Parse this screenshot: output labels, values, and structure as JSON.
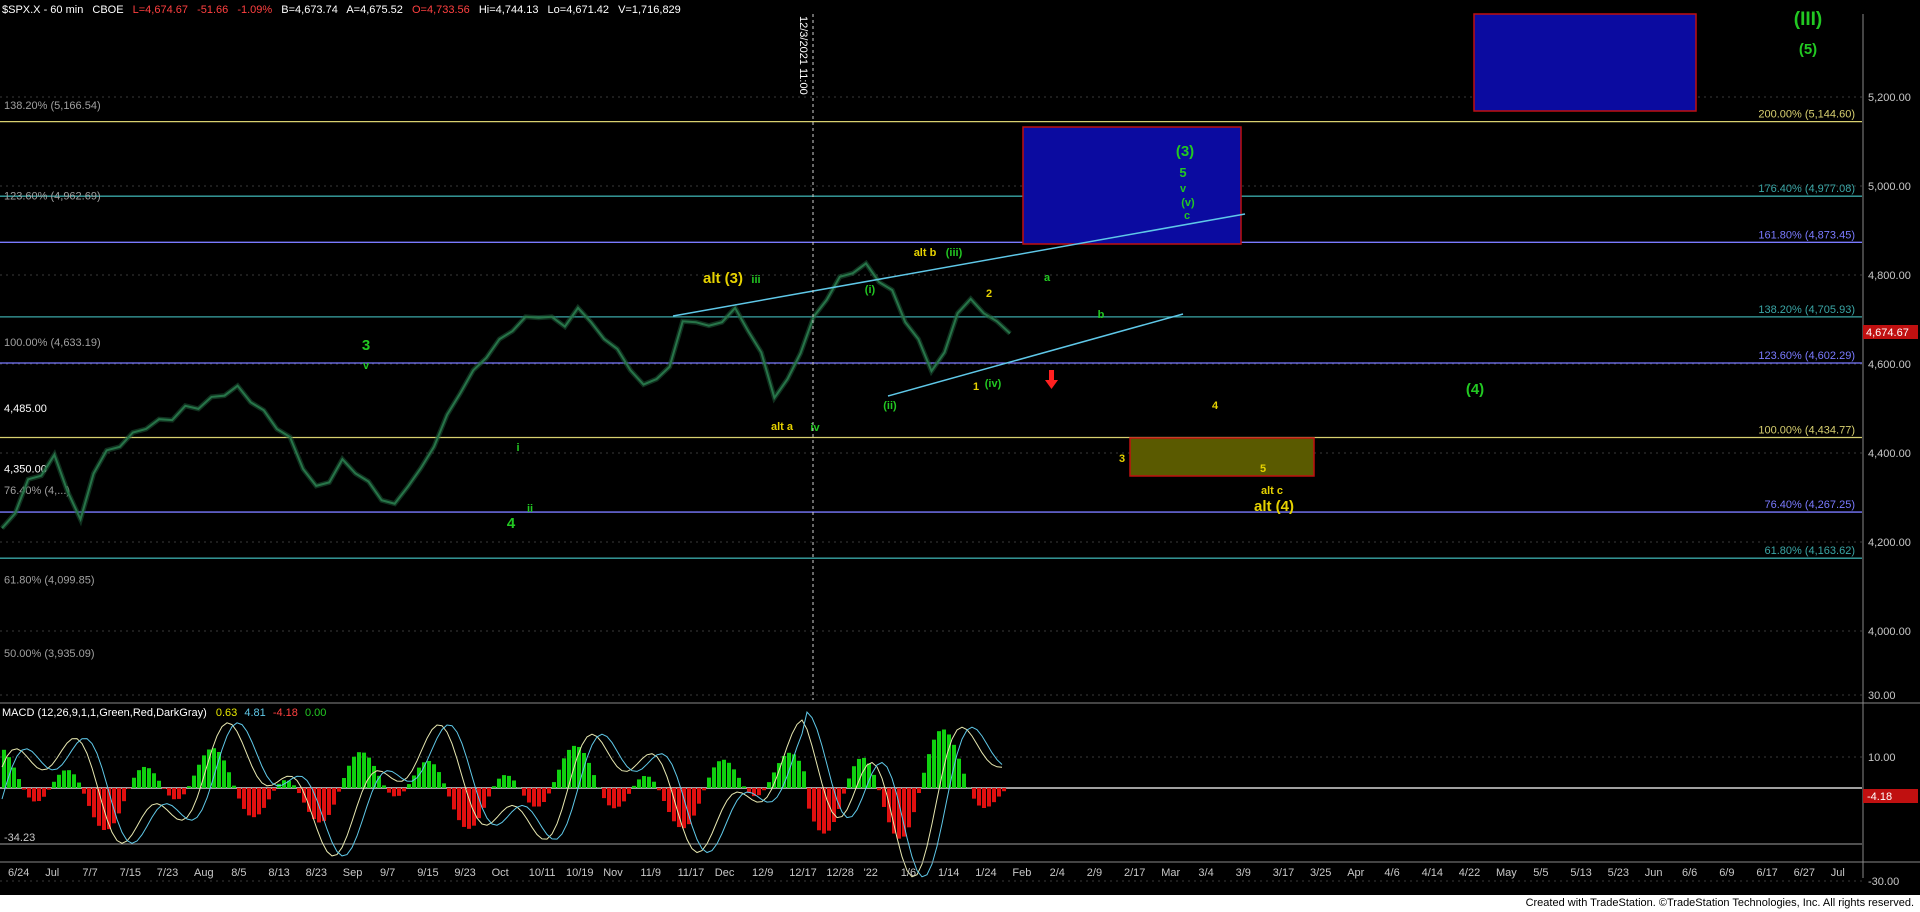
{
  "colors": {
    "background": "#000000",
    "price": "#2e8b57",
    "grid": "#3a3a3a",
    "axis_text": "#c8c8c8",
    "fib_yellow": "#d8d070",
    "fib_blue": "#7a7aff",
    "fib_teal": "#3aa6a6",
    "wave_green": "#22c822",
    "wave_yellow": "#e6d200",
    "box_blue": "#0b0ba0",
    "box_red": "#c01010",
    "box_olive": "#5a5a00",
    "trend": "#5fc8e8",
    "macd_pos": "#10d010",
    "macd_neg": "#e01010",
    "macd_line": "#e8e8b0"
  },
  "header": {
    "symbol": "$SPX.X - 60 min",
    "exchange": "CBOE",
    "last": "L=4,674.67",
    "change": "-51.66",
    "change_pct": "-1.09%",
    "bid": "B=4,673.74",
    "ask": "A=4,675.52",
    "open": "O=4,733.56",
    "high": "Hi=4,744.13",
    "low": "Lo=4,671.42",
    "volume": "V=1,716,829"
  },
  "cursor_date": "12/3/2021 11:00",
  "chart_data": {
    "type": "line",
    "price_axis": {
      "ticks": [
        "5,200.00",
        "5,000.00",
        "4,800.00",
        "4,600.00",
        "4,400.00",
        "4,200.00",
        "4,000.00"
      ],
      "last_price": "4,674.67"
    },
    "x_axis": {
      "ticks": [
        "6/24",
        "Jul",
        "7/7",
        "7/15",
        "7/23",
        "Aug",
        "8/5",
        "8/13",
        "8/23",
        "Sep",
        "9/7",
        "9/15",
        "9/23",
        "Oct",
        "10/11",
        "10/19",
        "Nov",
        "11/9",
        "11/17",
        "Dec",
        "12/9",
        "12/17",
        "12/28",
        "'22",
        "1/6",
        "1/14",
        "1/24",
        "Feb",
        "2/4",
        "2/9",
        "2/17",
        "Mar",
        "3/4",
        "3/9",
        "3/17",
        "3/25",
        "Apr",
        "4/6",
        "4/14",
        "4/22",
        "May",
        "5/5",
        "5/13",
        "5/23",
        "Jun",
        "6/6",
        "6/9",
        "6/17",
        "6/27",
        "Jul"
      ]
    },
    "series": [
      {
        "values": [
          4225,
          4270,
          4335,
          4355,
          4390,
          4320,
          4245,
          4360,
          4400,
          4420,
          4440,
          4460,
          4470,
          4480,
          4500,
          4505,
          4520,
          4535,
          4545,
          4520,
          4490,
          4460,
          4430,
          4370,
          4320,
          4340,
          4380,
          4360,
          4330,
          4300,
          4280,
          4330,
          4360,
          4420,
          4480,
          4540,
          4580,
          4620,
          4650,
          4680,
          4700,
          4710,
          4700,
          4690,
          4720,
          4700,
          4650,
          4640,
          4580,
          4560,
          4560,
          4600,
          4690,
          4700,
          4680,
          4700,
          4720,
          4680,
          4620,
          4530,
          4560,
          4630,
          4700,
          4750,
          4790,
          4810,
          4820,
          4790,
          4760,
          4700,
          4650,
          4590,
          4620,
          4720,
          4740,
          4720,
          4690,
          4674.67
        ]
      }
    ],
    "fib_levels": [
      {
        "label": "200.00% (5,144.60)",
        "side": "right",
        "value": 5144.6
      },
      {
        "label": "176.40% (4,977.08)",
        "side": "right",
        "value": 4977.08
      },
      {
        "label": "161.80% (4,873.45)",
        "side": "right",
        "value": 4873.45
      },
      {
        "label": "138.20% (4,705.93)",
        "side": "right",
        "value": 4705.93
      },
      {
        "label": "123.60% (4,602.29)",
        "side": "right",
        "value": 4602.29
      },
      {
        "label": "100.00% (4,434.77)",
        "side": "right",
        "value": 4434.77
      },
      {
        "label": "76.40% (4,267.25)",
        "side": "right",
        "value": 4267.25
      },
      {
        "label": "61.80% (4,163.62)",
        "side": "right",
        "value": 4163.62
      },
      {
        "label": "138.20% (5,166.54)",
        "side": "left",
        "value": 5166.54
      },
      {
        "label": "123.60% (4,962.69)",
        "side": "left",
        "value": 4962.69
      },
      {
        "label": "100.00% (4,633.19)",
        "side": "left",
        "value": 4633.19
      },
      {
        "label": "4,485.00",
        "side": "left",
        "value": 4485
      },
      {
        "label": "4,350.00",
        "side": "left",
        "value": 4350
      },
      {
        "label": "76.40% (4,...)",
        "side": "left",
        "value": 4301
      },
      {
        "label": "61.80% (4,099.85)",
        "side": "left",
        "value": 4099.85
      },
      {
        "label": "50.00% (3,935.09)",
        "side": "left",
        "value": 3935.09
      }
    ],
    "wave_labels_green": [
      "3",
      "v",
      "4",
      "i",
      "ii",
      "iii",
      "(i)",
      "(ii)",
      "(iii)",
      "(iv)",
      "iv",
      "a",
      "b",
      "c",
      "(v)",
      "v",
      "5",
      "(3)",
      "(4)",
      "(III)",
      "(5)"
    ],
    "wave_labels_yellow": [
      "alt (3)",
      "alt a",
      "alt b",
      "1",
      "2",
      "3",
      "4",
      "5",
      "alt c",
      "alt (4)"
    ],
    "macd": {
      "title": "MACD (12,26,9,1,1,Green,Red,DarkGray)",
      "v1": "0.63",
      "v2": "4.81",
      "v3": "-4.18",
      "v4": "0.00",
      "ticks": [
        "30.00",
        "10.00",
        "-30.00"
      ],
      "last": "-4.18",
      "low_label": "-34.23"
    }
  },
  "footer": "Created with TradeStation. ©TradeStation Technologies, Inc. All rights reserved."
}
